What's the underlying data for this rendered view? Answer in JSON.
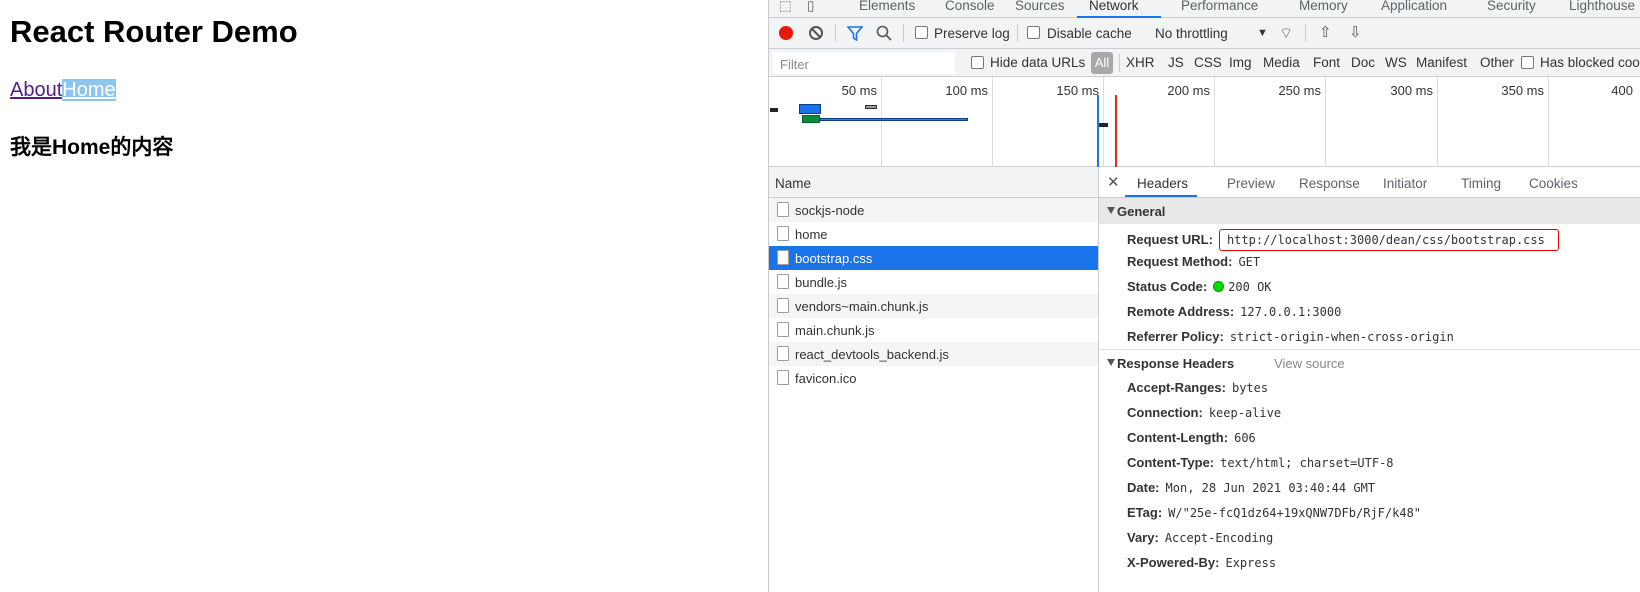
{
  "page": {
    "title": "React Router Demo",
    "links": [
      "About",
      "Home"
    ],
    "content": "我是Home的内容"
  },
  "devtools": {
    "tabs": [
      "Elements",
      "Console",
      "Sources",
      "Network",
      "Performance",
      "Memory",
      "Application",
      "Security",
      "Lighthouse"
    ],
    "active_tab": "Network",
    "toolbar": {
      "preserve_log": "Preserve log",
      "disable_cache": "Disable cache",
      "throttling": "No throttling"
    },
    "filter": {
      "placeholder": "Filter",
      "hide_data_urls": "Hide data URLs",
      "all": "All",
      "types": [
        "XHR",
        "JS",
        "CSS",
        "Img",
        "Media",
        "Font",
        "Doc",
        "WS",
        "Manifest",
        "Other"
      ],
      "has_blocked": "Has blocked cookies"
    },
    "timeline_ticks": [
      "50 ms",
      "100 ms",
      "150 ms",
      "200 ms",
      "250 ms",
      "300 ms",
      "350 ms",
      "400"
    ],
    "name_header": "Name",
    "requests": [
      "sockjs-node",
      "home",
      "bootstrap.css",
      "bundle.js",
      "vendors~main.chunk.js",
      "main.chunk.js",
      "react_devtools_backend.js",
      "favicon.ico"
    ],
    "selected_request": "bootstrap.css",
    "detail_tabs": [
      "Headers",
      "Preview",
      "Response",
      "Initiator",
      "Timing",
      "Cookies"
    ],
    "general": {
      "title": "General",
      "request_url_label": "Request URL:",
      "request_url": "http://localhost:3000/dean/css/bootstrap.css",
      "request_method_label": "Request Method:",
      "request_method": "GET",
      "status_code_label": "Status Code:",
      "status_code": "200 OK",
      "remote_address_label": "Remote Address:",
      "remote_address": "127.0.0.1:3000",
      "referrer_policy_label": "Referrer Policy:",
      "referrer_policy": "strict-origin-when-cross-origin"
    },
    "response_headers": {
      "title": "Response Headers",
      "view_source": "View source",
      "items": [
        {
          "k": "Accept-Ranges:",
          "v": "bytes"
        },
        {
          "k": "Connection:",
          "v": "keep-alive"
        },
        {
          "k": "Content-Length:",
          "v": "606"
        },
        {
          "k": "Content-Type:",
          "v": "text/html; charset=UTF-8"
        },
        {
          "k": "Date:",
          "v": "Mon, 28 Jun 2021 03:40:44 GMT"
        },
        {
          "k": "ETag:",
          "v": "W/\"25e-fcQ1dz64+19xQNW7DFb/RjF/k48\""
        },
        {
          "k": "Vary:",
          "v": "Accept-Encoding"
        },
        {
          "k": "X-Powered-By:",
          "v": "Express"
        }
      ]
    }
  }
}
